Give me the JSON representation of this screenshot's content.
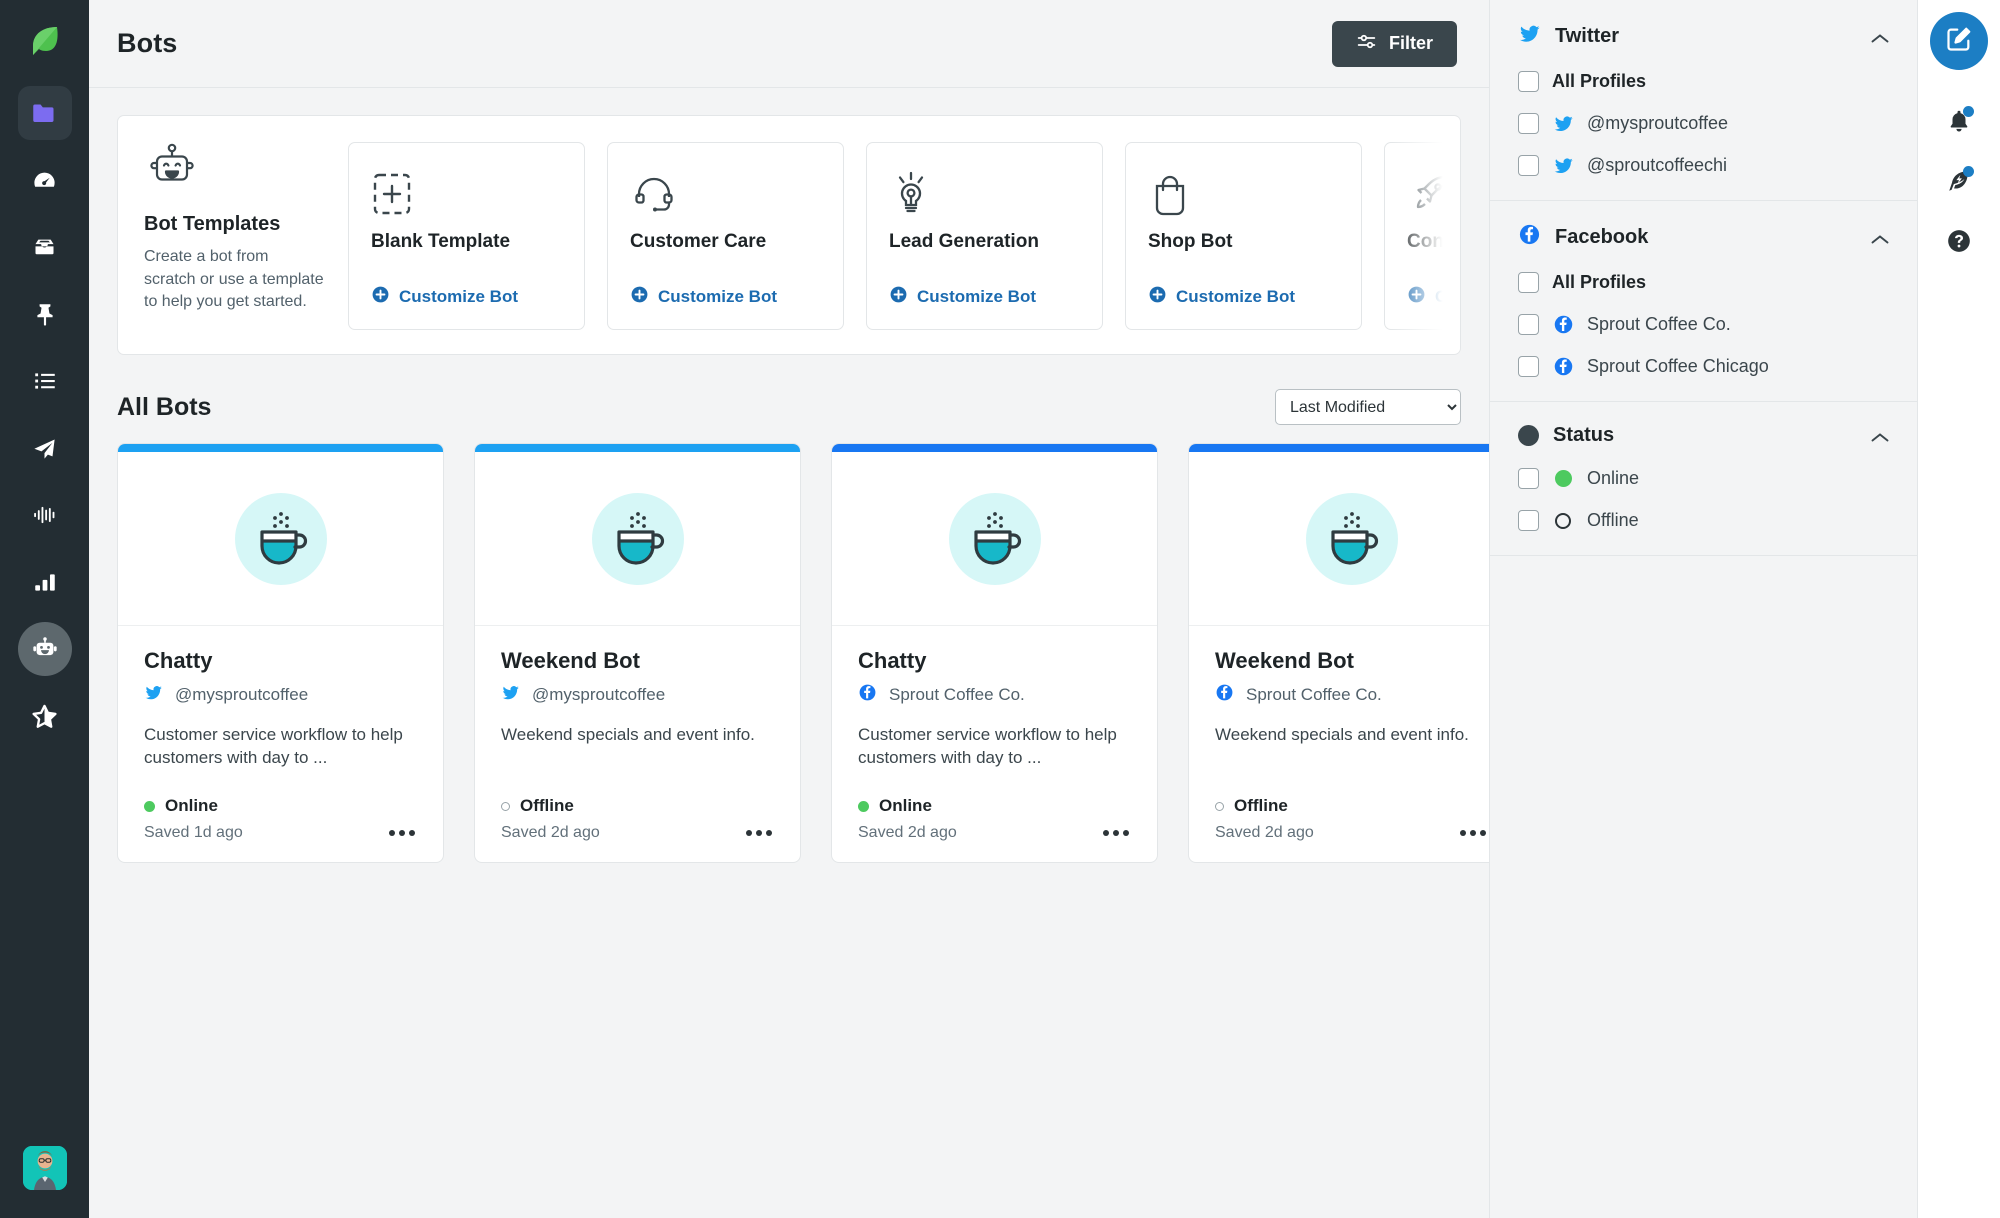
{
  "colors": {
    "brand_green": "#3dbf4f",
    "twitter_blue": "#1da1f2",
    "facebook_blue": "#1877f2",
    "link_blue": "#1c6bb0",
    "online_green": "#4dca5f",
    "nav_dark": "#232d33",
    "compose_blue": "#1c7ec4"
  },
  "left_nav": {
    "logo": "sprout-leaf-logo",
    "items": [
      {
        "icon": "folder-icon",
        "name": "assets",
        "active_box": true
      },
      {
        "icon": "gauge-icon",
        "name": "dashboard",
        "active_box": false
      },
      {
        "icon": "inbox-icon",
        "name": "smart-inbox",
        "active_box": false
      },
      {
        "icon": "pin-icon",
        "name": "pinned",
        "active_box": false
      },
      {
        "icon": "list-icon",
        "name": "tasks",
        "active_box": false
      },
      {
        "icon": "paper-plane-icon",
        "name": "publishing",
        "active_box": false
      },
      {
        "icon": "soundwave-icon",
        "name": "listening",
        "active_box": false
      },
      {
        "icon": "bar-chart-icon",
        "name": "reports",
        "active_box": false
      },
      {
        "icon": "robot-icon",
        "name": "bots",
        "active_box": false,
        "active_round": true
      },
      {
        "icon": "half-star-icon",
        "name": "reviews",
        "active_box": false
      }
    ],
    "avatar": "user-avatar-photo"
  },
  "header": {
    "title": "Bots",
    "filter_label": "Filter",
    "filter_icon": "sliders-icon"
  },
  "templates": {
    "heading": "Bot Templates",
    "description": "Create a bot from scratch or use a template to help you get started.",
    "header_icon": "robot-face-icon",
    "customize_label": "Customize Bot",
    "customize_icon": "circle-plus-icon",
    "cards": [
      {
        "name": "Blank Template",
        "icon": "dashed-square-plus-icon"
      },
      {
        "name": "Customer Care",
        "icon": "headset-icon"
      },
      {
        "name": "Lead Generation",
        "icon": "lightbulb-icon"
      },
      {
        "name": "Shop Bot",
        "icon": "shopping-bag-icon"
      },
      {
        "name": "Content D",
        "icon": "rocket-icon"
      }
    ]
  },
  "all_bots": {
    "heading": "All Bots",
    "sort_value": "Last Modified",
    "sort_options": [
      "Last Modified"
    ],
    "cards": [
      {
        "name": "Chatty",
        "network": "twitter",
        "network_icon": "twitter-bird-icon",
        "profile": "@mysproutcoffee",
        "description": "Customer service workflow to help customers with day to ...",
        "status": "Online",
        "online": true,
        "saved": "Saved 1d ago",
        "strip_color": "#1da1f2",
        "avatar_icon": "coffee-cup-icon"
      },
      {
        "name": "Weekend Bot",
        "network": "twitter",
        "network_icon": "twitter-bird-icon",
        "profile": "@mysproutcoffee",
        "description": "Weekend specials and event info.",
        "status": "Offline",
        "online": false,
        "saved": "Saved 2d ago",
        "strip_color": "#1da1f2",
        "avatar_icon": "coffee-cup-icon"
      },
      {
        "name": "Chatty",
        "network": "facebook",
        "network_icon": "facebook-icon",
        "profile": "Sprout Coffee Co.",
        "description": "Customer service workflow to help customers with day to ...",
        "status": "Online",
        "online": true,
        "saved": "Saved 2d ago",
        "strip_color": "#1877f2",
        "avatar_icon": "coffee-cup-icon"
      },
      {
        "name": "Weekend Bot",
        "network": "facebook",
        "network_icon": "facebook-icon",
        "profile": "Sprout Coffee Co.",
        "description": "Weekend specials and event info.",
        "status": "Offline",
        "online": false,
        "saved": "Saved 2d ago",
        "strip_color": "#1877f2",
        "avatar_icon": "coffee-cup-icon"
      }
    ]
  },
  "filter_panel": {
    "groups": [
      {
        "title": "Twitter",
        "icon": "twitter-bird-icon",
        "collapse_icon": "chevron-up-icon",
        "rows": [
          {
            "label": "All Profiles",
            "bold": true,
            "icon": null,
            "checked": false
          },
          {
            "label": "@mysproutcoffee",
            "bold": false,
            "icon": "twitter-bird-icon",
            "checked": false
          },
          {
            "label": "@sproutcoffeechi",
            "bold": false,
            "icon": "twitter-bird-icon",
            "checked": false
          }
        ]
      },
      {
        "title": "Facebook",
        "icon": "facebook-icon",
        "collapse_icon": "chevron-up-icon",
        "rows": [
          {
            "label": "All Profiles",
            "bold": true,
            "icon": null,
            "checked": false
          },
          {
            "label": "Sprout Coffee Co.",
            "bold": false,
            "icon": "facebook-icon",
            "checked": false
          },
          {
            "label": "Sprout Coffee Chicago",
            "bold": false,
            "icon": "facebook-icon",
            "checked": false
          }
        ]
      },
      {
        "title": "Status",
        "icon": "status-dot-icon",
        "collapse_icon": "chevron-up-icon",
        "rows": [
          {
            "label": "Online",
            "bold": false,
            "icon": "green-dot-icon",
            "checked": false
          },
          {
            "label": "Offline",
            "bold": false,
            "icon": "hollow-dot-icon",
            "checked": false
          }
        ]
      }
    ]
  },
  "right_rail": {
    "compose_icon": "compose-pencil-icon",
    "items": [
      {
        "icon": "bell-icon",
        "name": "notifications",
        "badge": true
      },
      {
        "icon": "feather-bolt-icon",
        "name": "whats-new",
        "badge": true
      },
      {
        "icon": "question-circle-icon",
        "name": "help",
        "badge": false
      }
    ]
  }
}
